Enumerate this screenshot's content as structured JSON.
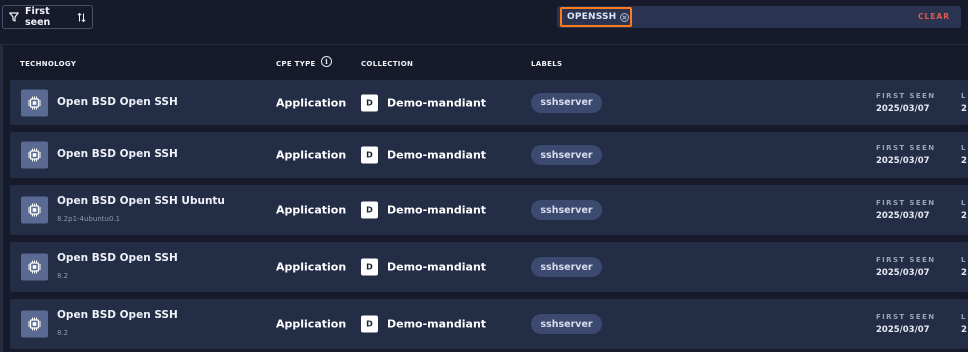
{
  "toolbar": {
    "sort_label": "First seen",
    "filter_icon": "filter-icon",
    "sort_icon": "sort-arrows-icon"
  },
  "search": {
    "chip_label": "OPENSSH",
    "clear_label": "CLEAR",
    "highlight_color": "#ff7a1a"
  },
  "columns": {
    "technology": "TECHNOLOGY",
    "cpe_type": "CPE TYPE",
    "collection": "COLLECTION",
    "labels": "LABELS"
  },
  "rows": [
    {
      "name": "Open BSD Open SSH",
      "version": "",
      "cpe_type": "Application",
      "collection_initial": "D",
      "collection": "Demo-mandiant",
      "label": "sshserver",
      "first_seen_label": "FIRST SEEN",
      "first_seen": "2025/03/07",
      "last_seen_label": "L",
      "last_seen": "2"
    },
    {
      "name": "Open BSD Open SSH",
      "version": "",
      "cpe_type": "Application",
      "collection_initial": "D",
      "collection": "Demo-mandiant",
      "label": "sshserver",
      "first_seen_label": "FIRST SEEN",
      "first_seen": "2025/03/07",
      "last_seen_label": "L",
      "last_seen": "2"
    },
    {
      "name": "Open BSD Open SSH Ubuntu",
      "version": "8.2p1-4ubuntu0.1",
      "cpe_type": "Application",
      "collection_initial": "D",
      "collection": "Demo-mandiant",
      "label": "sshserver",
      "first_seen_label": "FIRST SEEN",
      "first_seen": "2025/03/07",
      "last_seen_label": "L",
      "last_seen": "2"
    },
    {
      "name": "Open BSD Open SSH",
      "version": "8.2",
      "cpe_type": "Application",
      "collection_initial": "D",
      "collection": "Demo-mandiant",
      "label": "sshserver",
      "first_seen_label": "FIRST SEEN",
      "first_seen": "2025/03/07",
      "last_seen_label": "L",
      "last_seen": "2"
    },
    {
      "name": "Open BSD Open SSH",
      "version": "8.2",
      "cpe_type": "Application",
      "collection_initial": "D",
      "collection": "Demo-mandiant",
      "label": "sshserver",
      "first_seen_label": "FIRST SEEN",
      "first_seen": "2025/03/07",
      "last_seen_label": "L",
      "last_seen": "2"
    }
  ]
}
